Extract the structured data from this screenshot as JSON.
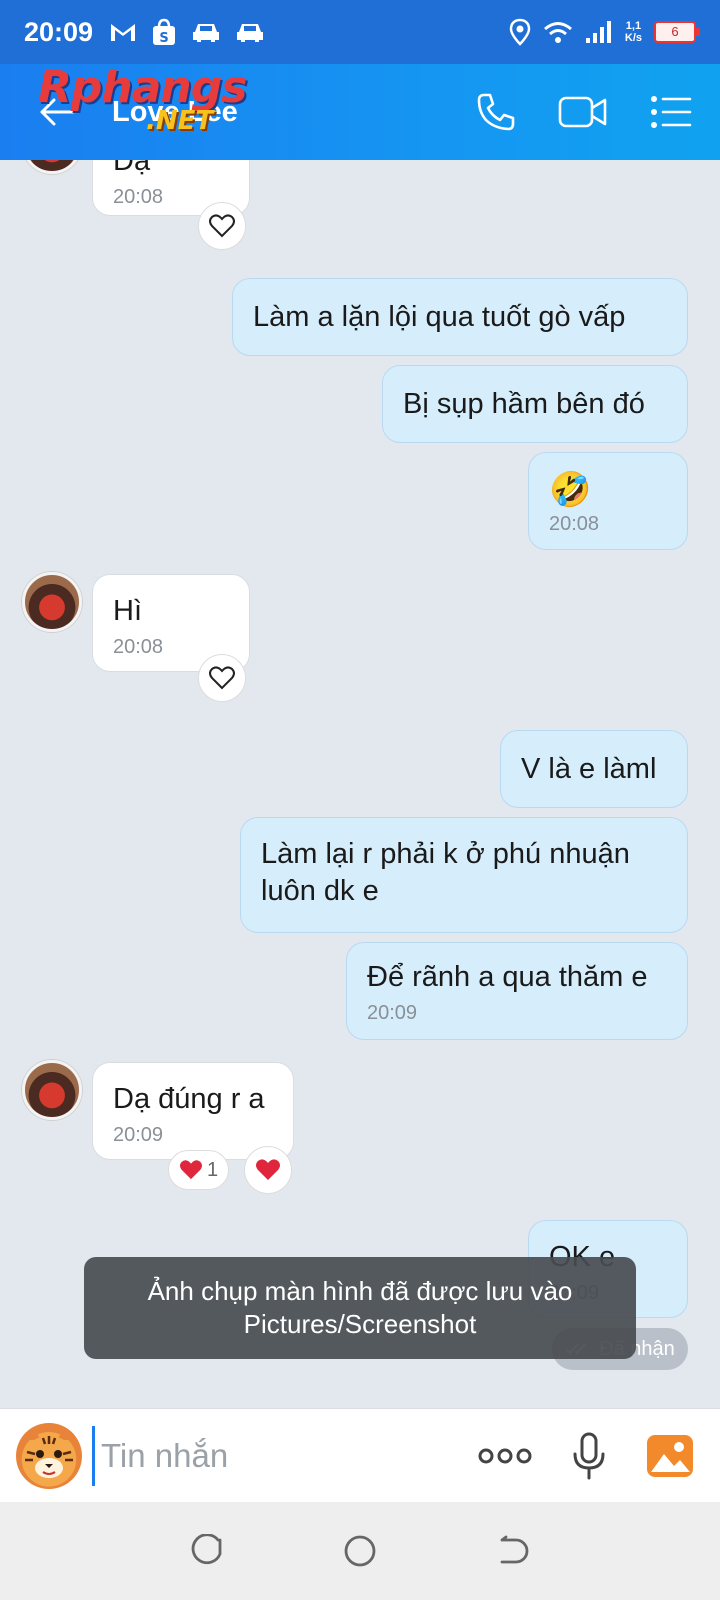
{
  "status_bar": {
    "time": "20:09",
    "speed_top": "1,1",
    "speed_bottom": "K/s",
    "battery": "6"
  },
  "header": {
    "title": "Love Lee",
    "watermark_top": "Rphangs",
    "watermark_bottom": ".NET"
  },
  "messages": [
    {
      "side": "in",
      "text": "Dạ",
      "time": "20:08"
    },
    {
      "side": "out",
      "text": "Làm a lặn lội qua tuốt gò vấp"
    },
    {
      "side": "out",
      "text": "Bị sụp hầm bên đó"
    },
    {
      "side": "out",
      "text": "🤣",
      "time": "20:08"
    },
    {
      "side": "in",
      "text": "Hì",
      "time": "20:08"
    },
    {
      "side": "out",
      "text": "V là e làml"
    },
    {
      "side": "out",
      "text": "Làm lại r phải k ở phú nhuận luôn dk e"
    },
    {
      "side": "out",
      "text": "Để rãnh a qua thăm e",
      "time": "20:09"
    },
    {
      "side": "in",
      "text": "Dạ đúng r a",
      "time": "20:09"
    },
    {
      "side": "out",
      "text": "OK e",
      "time": "20:09"
    }
  ],
  "reaction_count": "1",
  "delivery_status": "Đã nhận",
  "toast": {
    "line1": "Ảnh chụp màn hình đã được lưu vào",
    "line2": "Pictures/Screenshot"
  },
  "composer": {
    "placeholder": "Tin nhắn"
  },
  "colors": {
    "header": "#1a7ef0",
    "incoming_bubble": "#ffffff",
    "outgoing_bubble": "#d6edfb",
    "chat_background": "#e3e8ef"
  }
}
